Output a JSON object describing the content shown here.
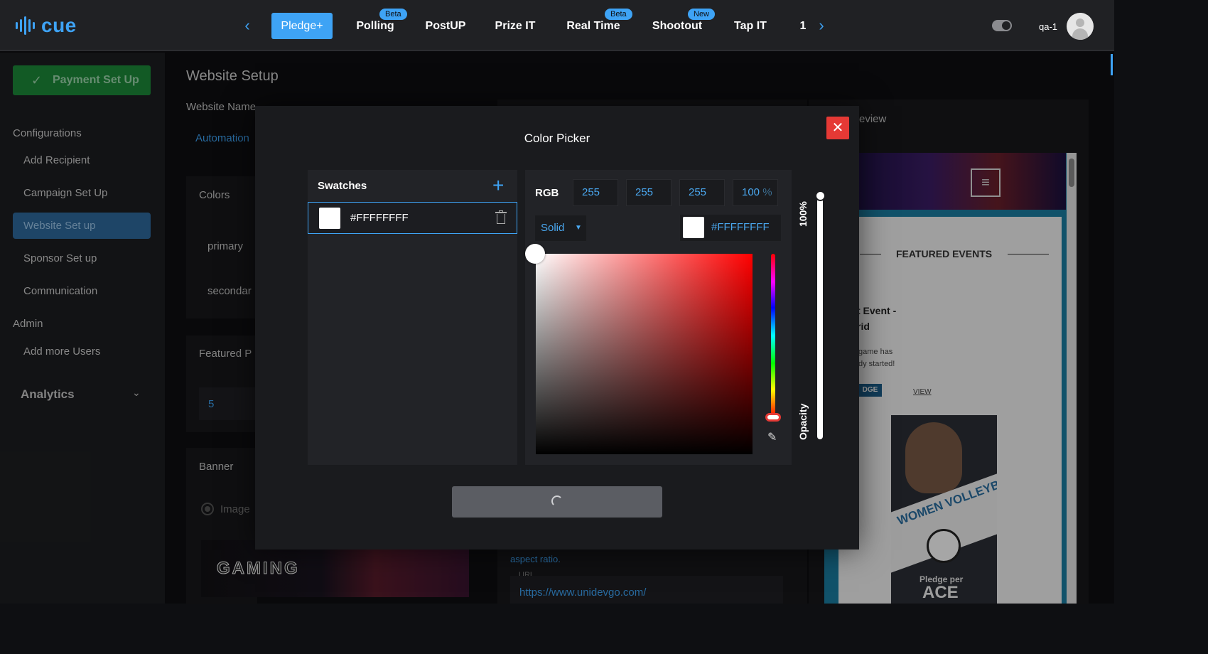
{
  "header": {
    "logo_text": "cue",
    "tabs": [
      {
        "label": "Pledge+",
        "badge": ""
      },
      {
        "label": "Polling",
        "badge": "Beta"
      },
      {
        "label": "PostUP",
        "badge": ""
      },
      {
        "label": "Prize IT",
        "badge": ""
      },
      {
        "label": "Real Time",
        "badge": "Beta"
      },
      {
        "label": "Shootout",
        "badge": "New"
      },
      {
        "label": "Tap IT",
        "badge": ""
      },
      {
        "label": "1",
        "badge": ""
      }
    ],
    "prev_arrow": "‹",
    "next_arrow": "›",
    "username": "qa-1"
  },
  "sidebar": {
    "payment_button": "Payment Set Up",
    "section_configurations": "Configurations",
    "items": [
      "Add Recipient",
      "Campaign Set Up",
      "Website Set up",
      "Sponsor Set up",
      "Communication"
    ],
    "section_admin": "Admin",
    "admin_items": [
      "Add more Users"
    ],
    "analytics": "Analytics"
  },
  "main": {
    "title": "Website Setup",
    "website_name_label": "Website Name",
    "website_name_value": "Automation",
    "colors_label": "Colors",
    "primary_label": "primary",
    "secondary_label": "secondar",
    "featured_label": "Featured P",
    "featured_value": "5",
    "banner_label": "Banner",
    "image_option": "Image",
    "banner_text": "GAMING",
    "aspect_ratio_text": "aspect ratio.",
    "url_label": "URL",
    "url_value": "https://www.unidevgo.com/"
  },
  "preview": {
    "label": "eview",
    "featured_heading": "FEATURED EVENTS",
    "event_title_line1": "t Event -",
    "event_title_line2": "rid",
    "event_sub_line1": "game has",
    "event_sub_line2": "dy started!",
    "pledge_chip": "DGE",
    "view_link": "VIEW",
    "card_title": "WOMEN VOLLEYBALL",
    "card_pledge": "Pledge per",
    "card_ace": "ACE"
  },
  "color_picker": {
    "title": "Color Picker",
    "swatches_title": "Swatches",
    "swatch_hex": "#FFFFFFFF",
    "rgb_label": "RGB",
    "r": "255",
    "g": "255",
    "b": "255",
    "alpha": "100",
    "alpha_unit": "%",
    "mode": "Solid",
    "hex_value": "#FFFFFFFF",
    "opacity_value": "100%",
    "opacity_label": "Opacity",
    "accent_color": "#3ea3f5",
    "close_color": "#e53935"
  }
}
